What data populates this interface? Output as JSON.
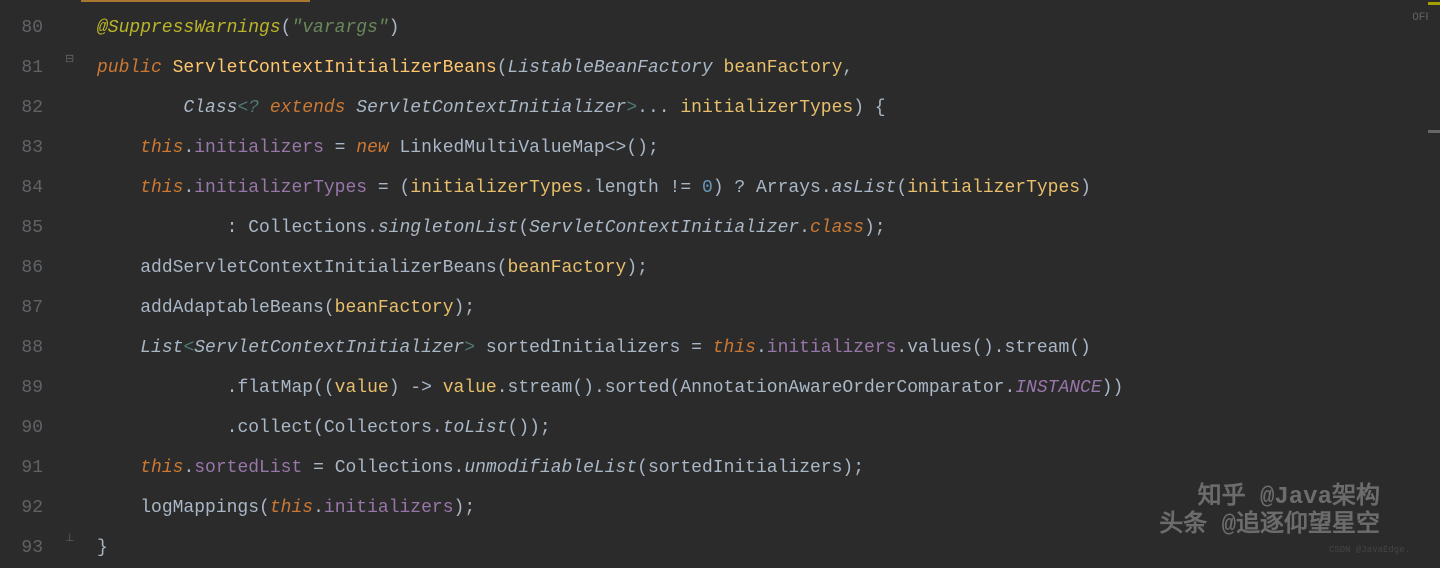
{
  "lineNumbers": [
    "80",
    "81",
    "82",
    "83",
    "84",
    "85",
    "86",
    "87",
    "88",
    "89",
    "90",
    "91",
    "92",
    "93"
  ],
  "offIndicator": "OFF",
  "code": {
    "l80": {
      "anno": "@SuppressWarnings",
      "paren1": "(",
      "str": "\"varargs\"",
      "paren2": ")"
    },
    "l81": {
      "kw": "public",
      "ctor": "ServletContextInitializerBeans",
      "paren1": "(",
      "type": "ListableBeanFactory",
      "param": "beanFactory",
      "comma": ","
    },
    "l82": {
      "type1": "Class",
      "gen1": "<?",
      "kw": "extends",
      "type2": "ServletContextInitializer",
      "gen2": ">",
      "varargs": "...",
      "param": "initializerTypes",
      "paren": ") {"
    },
    "l83": {
      "kw1": "this",
      "dot1": ".",
      "field": "initializers",
      "eq": " = ",
      "kw2": "new",
      "type": "LinkedMultiValueMap",
      "gen": "<>",
      "paren": "();"
    },
    "l84": {
      "kw": "this",
      "dot1": ".",
      "field": "initializerTypes",
      "eq": " = (",
      "param": "initializerTypes",
      "dot2": ".",
      "prop": "length",
      "neq": " != ",
      "num": "0",
      "tern": ") ? ",
      "type": "Arrays",
      "dot3": ".",
      "method": "asList",
      "paren1": "(",
      "param2": "initializerTypes",
      "paren2": ")"
    },
    "l85": {
      "colon": ": ",
      "type1": "Collections",
      "dot1": ".",
      "method": "singletonList",
      "paren1": "(",
      "type2": "ServletContextInitializer",
      "dot2": ".",
      "kw": "class",
      "paren2": ");"
    },
    "l86": {
      "method": "addServletContextInitializerBeans",
      "paren1": "(",
      "param": "beanFactory",
      "paren2": ");"
    },
    "l87": {
      "method": "addAdaptableBeans",
      "paren1": "(",
      "param": "beanFactory",
      "paren2": ");"
    },
    "l88": {
      "type1": "List",
      "gen1": "<",
      "type2": "ServletContextInitializer",
      "gen2": ">",
      "var": " sortedInitializers = ",
      "kw": "this",
      "dot1": ".",
      "field": "initializers",
      "dot2": ".",
      "method1": "values",
      "paren1": "().",
      "method2": "stream",
      "paren2": "()"
    },
    "l89": {
      "dot1": ".",
      "method1": "flatMap",
      "paren1": "((",
      "param": "value",
      "arrow": ") -> ",
      "param2": "value",
      "dot2": ".",
      "method2": "stream",
      "paren2": "().",
      "method3": "sorted",
      "paren3": "(",
      "type": "AnnotationAwareOrderComparator",
      "dot3": ".",
      "constant": "INSTANCE",
      "paren4": "))"
    },
    "l90": {
      "dot1": ".",
      "method1": "collect",
      "paren1": "(",
      "type": "Collectors",
      "dot2": ".",
      "method2": "toList",
      "paren2": "());"
    },
    "l91": {
      "kw": "this",
      "dot1": ".",
      "field": "sortedList",
      "eq": " = ",
      "type": "Collections",
      "dot2": ".",
      "method": "unmodifiableList",
      "paren1": "(",
      "var": "sortedInitializers",
      "paren2": ");"
    },
    "l92": {
      "method": "logMappings",
      "paren1": "(",
      "kw": "this",
      "dot": ".",
      "field": "initializers",
      "paren2": ");"
    },
    "l93": {
      "brace": "}"
    }
  },
  "watermark1": "知乎 @Java架构",
  "watermark2": "头条 @追逐仰望星空",
  "watermark3": "CSDN @JavaEdge."
}
